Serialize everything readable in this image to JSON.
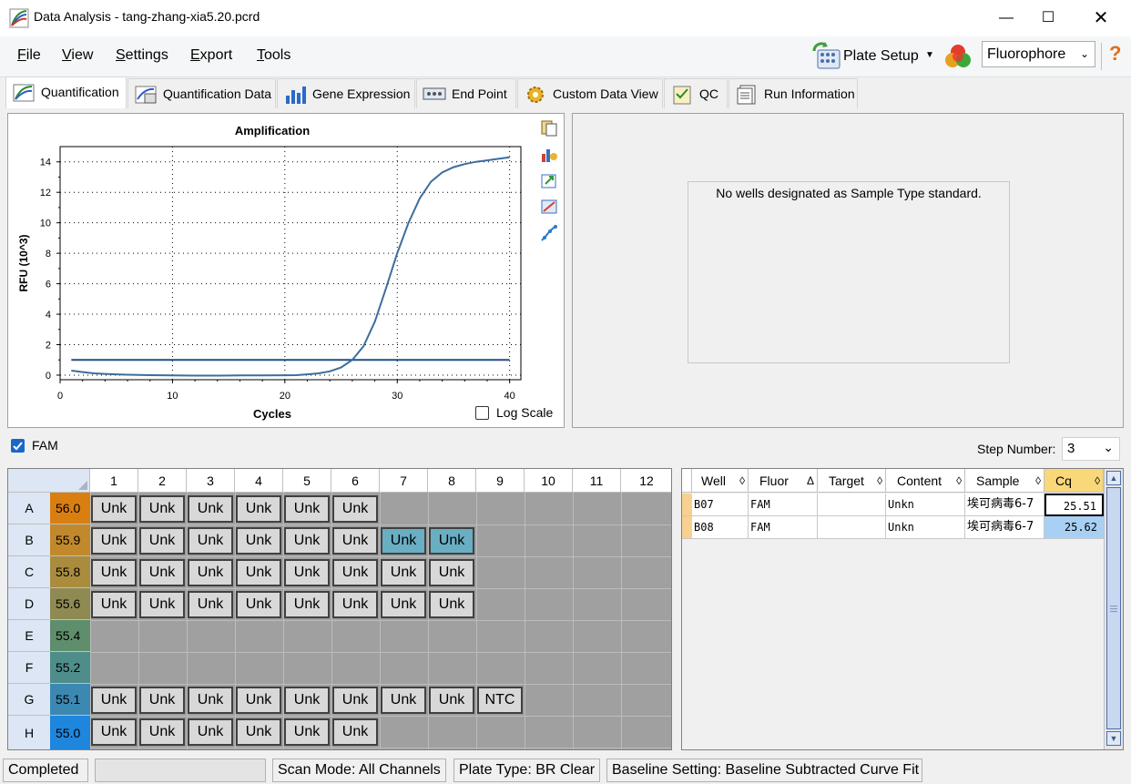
{
  "window": {
    "title": "Data Analysis - tang-zhang-xia5.20.pcrd"
  },
  "menu": {
    "file": "File",
    "view": "View",
    "settings": "Settings",
    "export": "Export",
    "tools": "Tools"
  },
  "toolbar": {
    "plate_setup": "Plate Setup",
    "fluorophore": "Fluorophore",
    "help": "?"
  },
  "tabs": [
    "Quantification",
    "Quantification Data",
    "Gene Expression",
    "End Point",
    "Custom Data View",
    "QC",
    "Run Information"
  ],
  "chart_data": {
    "type": "line",
    "title": "Amplification",
    "xlabel": "Cycles",
    "ylabel": "RFU (10^3)",
    "xlim": [
      0,
      41
    ],
    "ylim": [
      -0.3,
      15
    ],
    "xticks": [
      0,
      10,
      20,
      30,
      40
    ],
    "yticks": [
      0,
      2,
      4,
      6,
      8,
      10,
      12,
      14
    ],
    "grid": true,
    "log_scale": false,
    "log_scale_label": "Log Scale",
    "threshold": 1.0,
    "series": [
      {
        "color": "#3c6e9c",
        "x": [
          1,
          2,
          3,
          4,
          5,
          6,
          8,
          10,
          12,
          14,
          16,
          18,
          20,
          21,
          22,
          23,
          24,
          25,
          26,
          27,
          28,
          29,
          30,
          31,
          32,
          33,
          34,
          35,
          36,
          37,
          38,
          39,
          40
        ],
        "y": [
          0.3,
          0.2,
          0.12,
          0.08,
          0.05,
          0.03,
          0.0,
          -0.02,
          -0.03,
          -0.03,
          -0.02,
          -0.02,
          -0.01,
          0.0,
          0.05,
          0.12,
          0.25,
          0.5,
          1.0,
          1.9,
          3.5,
          5.7,
          8.0,
          10.0,
          11.6,
          12.7,
          13.3,
          13.65,
          13.85,
          14.0,
          14.1,
          14.2,
          14.3
        ]
      }
    ]
  },
  "standard_panel": {
    "message": "No wells designated as Sample Type standard."
  },
  "fluor_filter": {
    "label": "FAM",
    "checked": true
  },
  "step": {
    "label": "Step Number:",
    "value": "3"
  },
  "plate": {
    "columns": [
      "1",
      "2",
      "3",
      "4",
      "5",
      "6",
      "7",
      "8",
      "9",
      "10",
      "11",
      "12"
    ],
    "rows": [
      {
        "row": "A",
        "temp": "56.0",
        "temp_color": "#d97f12",
        "wells": [
          "Unk",
          "Unk",
          "Unk",
          "Unk",
          "Unk",
          "Unk",
          "",
          "",
          "",
          "",
          "",
          ""
        ]
      },
      {
        "row": "B",
        "temp": "55.9",
        "temp_color": "#c1892b",
        "wells": [
          "Unk",
          "Unk",
          "Unk",
          "Unk",
          "Unk",
          "Unk",
          "Unk",
          "Unk",
          "",
          "",
          "",
          ""
        ]
      },
      {
        "row": "C",
        "temp": "55.8",
        "temp_color": "#a98c3e",
        "wells": [
          "Unk",
          "Unk",
          "Unk",
          "Unk",
          "Unk",
          "Unk",
          "Unk",
          "Unk",
          "",
          "",
          "",
          ""
        ]
      },
      {
        "row": "D",
        "temp": "55.6",
        "temp_color": "#8e8a52",
        "wells": [
          "Unk",
          "Unk",
          "Unk",
          "Unk",
          "Unk",
          "Unk",
          "Unk",
          "Unk",
          "",
          "",
          "",
          ""
        ]
      },
      {
        "row": "E",
        "temp": "55.4",
        "temp_color": "#5f8e6c",
        "wells": [
          "",
          "",
          "",
          "",
          "",
          "",
          "",
          "",
          "",
          "",
          "",
          ""
        ]
      },
      {
        "row": "F",
        "temp": "55.2",
        "temp_color": "#4e8d8a",
        "wells": [
          "",
          "",
          "",
          "",
          "",
          "",
          "",
          "",
          "",
          "",
          "",
          ""
        ]
      },
      {
        "row": "G",
        "temp": "55.1",
        "temp_color": "#3b88b3",
        "wells": [
          "Unk",
          "Unk",
          "Unk",
          "Unk",
          "Unk",
          "Unk",
          "Unk",
          "Unk",
          "NTC",
          "",
          "",
          ""
        ]
      },
      {
        "row": "H",
        "temp": "55.0",
        "temp_color": "#1f86dd",
        "wells": [
          "Unk",
          "Unk",
          "Unk",
          "Unk",
          "Unk",
          "Unk",
          "",
          "",
          "",
          "",
          "",
          ""
        ]
      }
    ],
    "selected": [
      "B7",
      "B8"
    ]
  },
  "table": {
    "headers": [
      "Well",
      "Fluor",
      "Target",
      "Content",
      "Sample",
      "Cq"
    ],
    "rows": [
      {
        "well": "B07",
        "fluor": "FAM",
        "target": "",
        "content": "Unkn",
        "sample": "埃可病毒6-7",
        "cq": "25.51"
      },
      {
        "well": "B08",
        "fluor": "FAM",
        "target": "",
        "content": "Unkn",
        "sample": "埃可病毒6-7",
        "cq": "25.62"
      }
    ]
  },
  "status": {
    "state": "Completed",
    "scan_mode": "Scan Mode: All Channels",
    "plate_type": "Plate Type: BR Clear",
    "baseline": "Baseline Setting: Baseline Subtracted Curve Fit"
  }
}
